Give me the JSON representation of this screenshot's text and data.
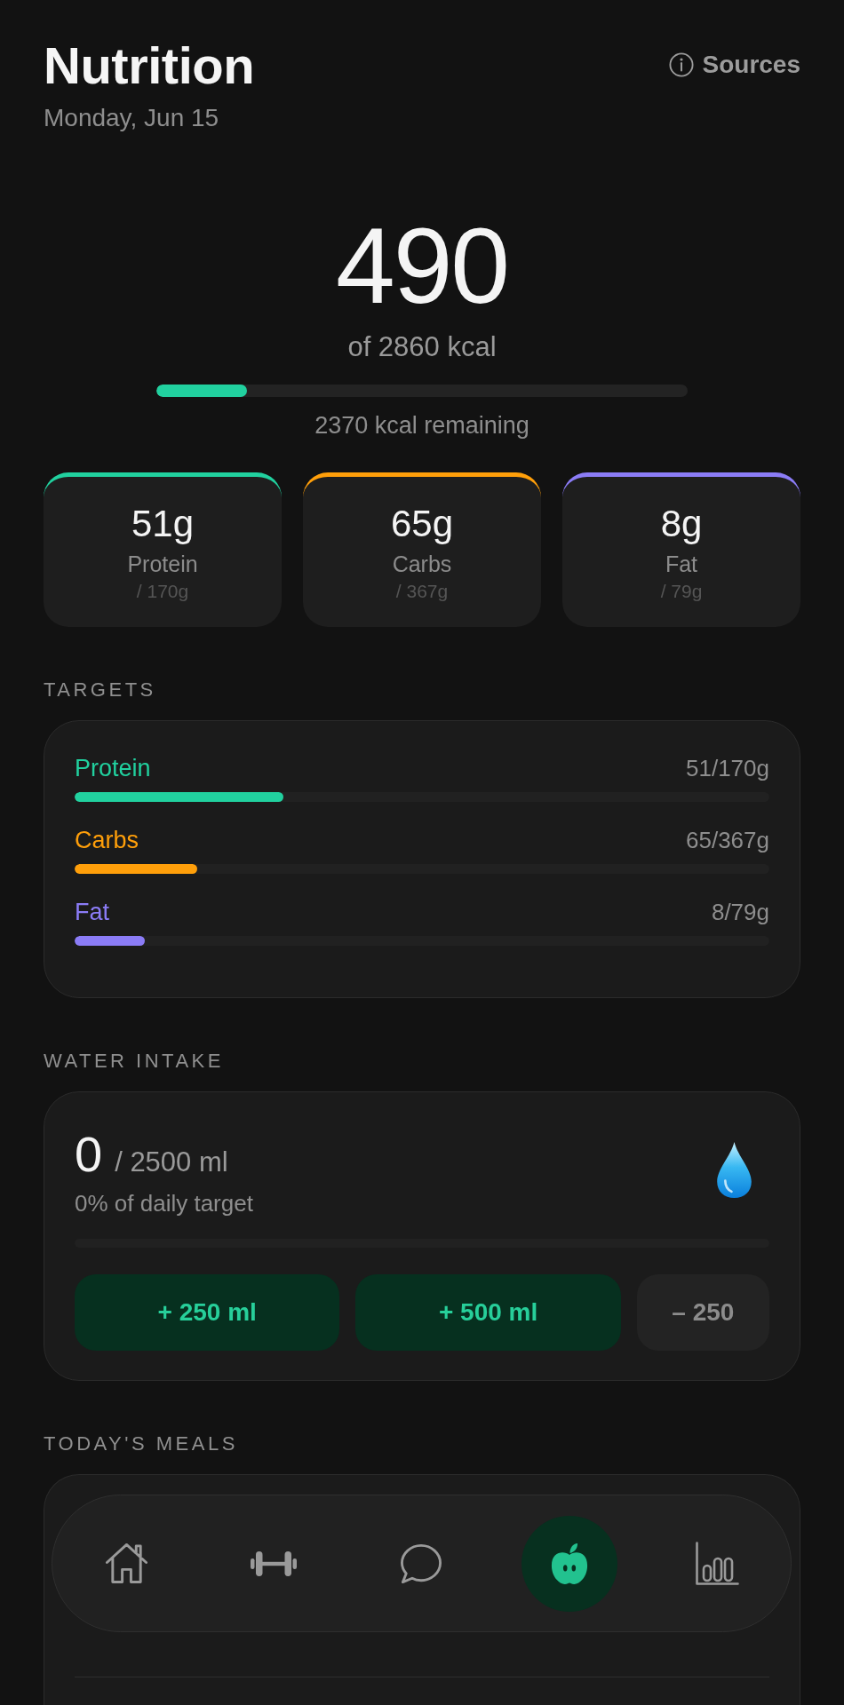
{
  "header": {
    "title": "Nutrition",
    "date": "Monday, Jun 15",
    "sources_label": "Sources"
  },
  "calories": {
    "consumed": "490",
    "goal": "of 2860 kcal",
    "level": 0.171,
    "remaining": "2370 kcal remaining"
  },
  "macros": [
    {
      "amount": "51g",
      "label": "Protein",
      "target": "/ 170g",
      "color": "#21d19f"
    },
    {
      "amount": "65g",
      "label": "Carbs",
      "target": "/ 367g",
      "color": "#ff9f0a"
    },
    {
      "amount": "8g",
      "label": "Fat",
      "target": "/ 79g",
      "color": "#8b7cf6"
    }
  ],
  "targets": {
    "heading": "TARGETS",
    "items": [
      {
        "label": "Protein",
        "reading": "51/170g",
        "level": 0.3,
        "color": "#21d19f"
      },
      {
        "label": "Carbs",
        "reading": "65/367g",
        "level": 0.177,
        "color": "#ff9f0a"
      },
      {
        "label": "Fat",
        "reading": "8/79g",
        "level": 0.101,
        "color": "#8b7cf6"
      }
    ]
  },
  "water": {
    "heading": "WATER INTAKE",
    "amount": "0",
    "goal": "/ 2500 ml",
    "caption": "0% of daily target",
    "level": 0,
    "buttons": [
      {
        "label": "+ 250 ml",
        "kind": "add"
      },
      {
        "label": "+ 500 ml",
        "kind": "add"
      },
      {
        "label": "– 250",
        "kind": "remove"
      }
    ]
  },
  "meals": {
    "heading": "TODAY'S MEALS"
  },
  "tab_bar": {
    "items": [
      {
        "kind": "home",
        "selected": false
      },
      {
        "kind": "dumbbell",
        "selected": false
      },
      {
        "kind": "chat",
        "selected": false
      },
      {
        "kind": "apple",
        "selected": true
      },
      {
        "kind": "chart",
        "selected": false
      }
    ]
  }
}
